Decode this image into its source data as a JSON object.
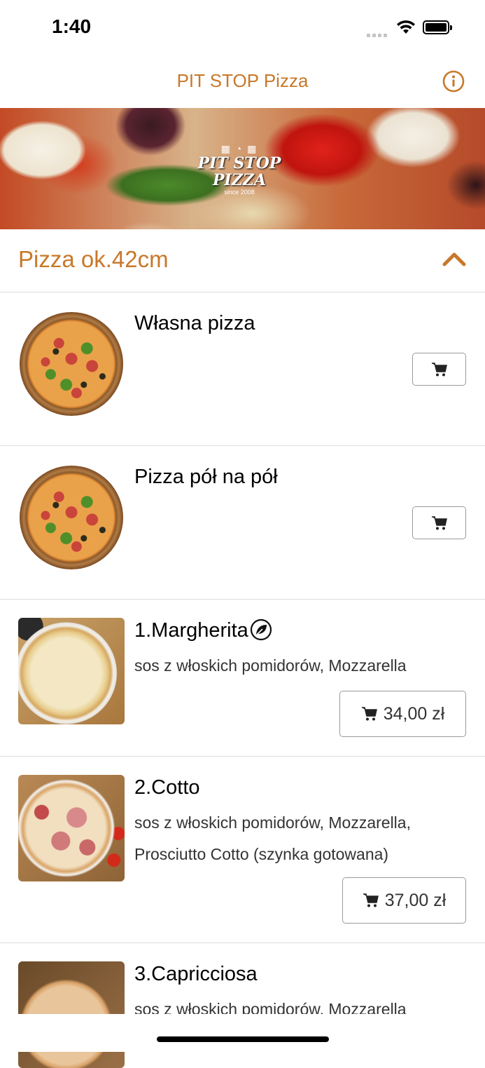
{
  "status_bar": {
    "time": "1:40"
  },
  "nav": {
    "title": "PIT STOP Pizza",
    "info_icon": "info-circle-icon"
  },
  "hero": {
    "logo_text": "PIT STOP PIZZA",
    "logo_since": "since 2008"
  },
  "category": {
    "title": "Pizza ok.42cm",
    "icon": "chevron-up-icon"
  },
  "colors": {
    "accent": "#c8782a",
    "divider": "#dcdcdc"
  },
  "items": [
    {
      "name": "Własna pizza",
      "desc_lines": [],
      "price": ""
    },
    {
      "name": "Pizza pół na pół",
      "desc_lines": [],
      "price": ""
    },
    {
      "name": "1.Margherita",
      "desc_lines": [
        " sos z włoskich pomidorów, Mozzarella"
      ],
      "price": "34,00 zł",
      "badge": "vegetarian-leaf-icon"
    },
    {
      "name": "2.Cotto",
      "desc_lines": [
        " sos z włoskich pomidorów, Mozzarella,",
        "Prosciutto Cotto (szynka gotowana)"
      ],
      "price": "37,00 zł"
    },
    {
      "name": "3.Capricciosa",
      "desc_lines": [
        " sos z włoskich pomidorów, Mozzarella"
      ],
      "price": ""
    }
  ]
}
